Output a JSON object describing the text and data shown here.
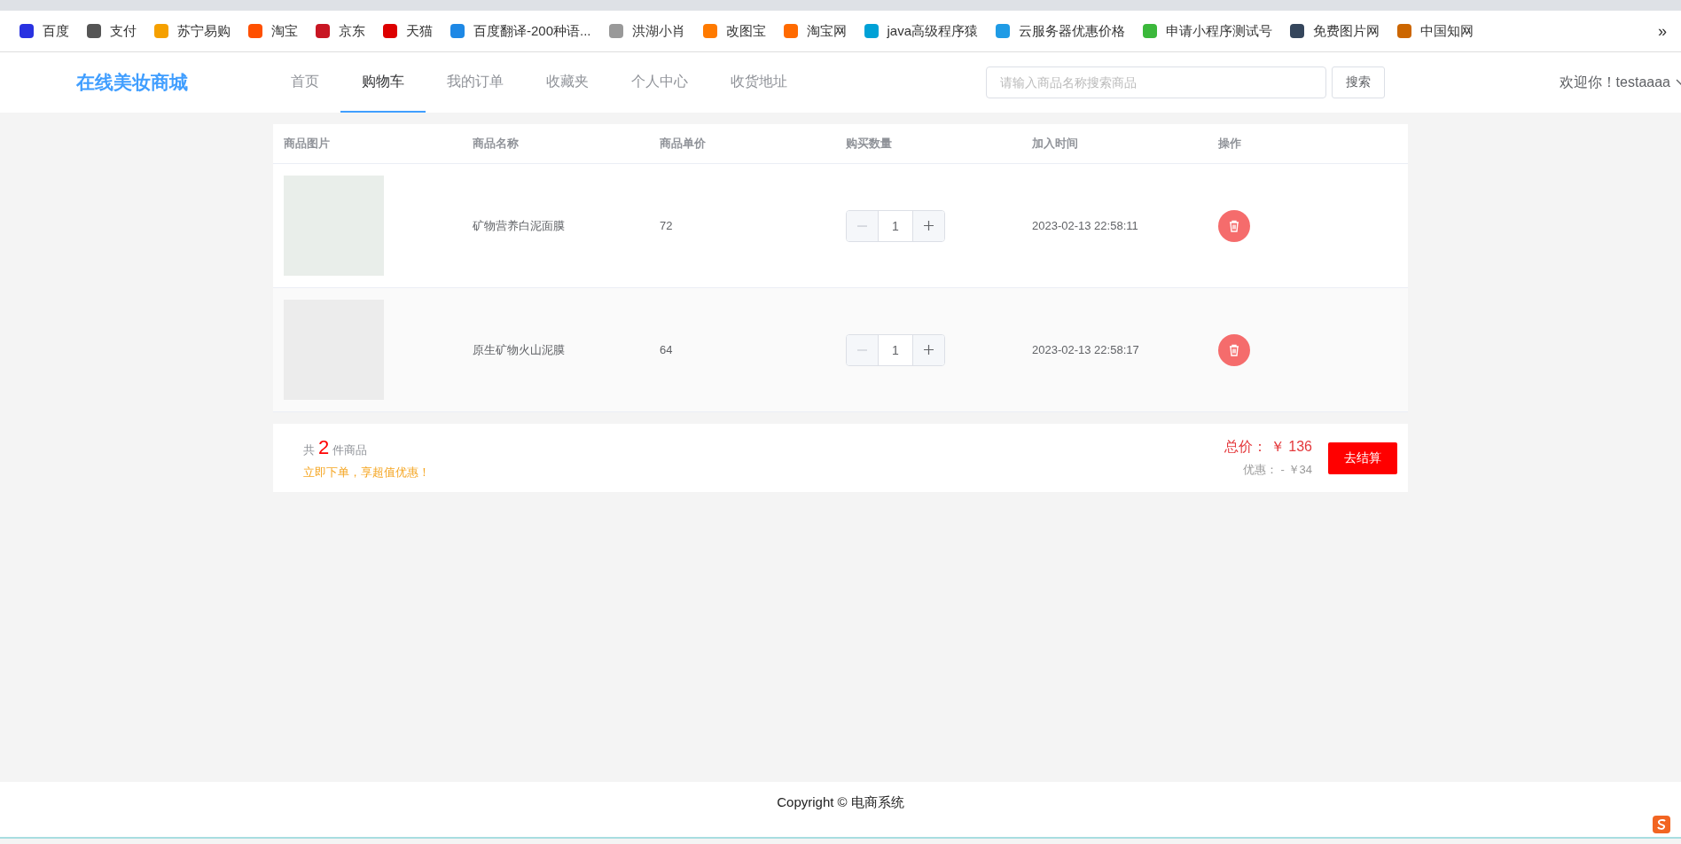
{
  "bookmarks": [
    {
      "label": "百度"
    },
    {
      "label": "支付"
    },
    {
      "label": "苏宁易购"
    },
    {
      "label": "淘宝"
    },
    {
      "label": "京东"
    },
    {
      "label": "天猫"
    },
    {
      "label": "百度翻译-200种语..."
    },
    {
      "label": "洪湖小肖"
    },
    {
      "label": "改图宝"
    },
    {
      "label": "淘宝网"
    },
    {
      "label": "java高级程序猿"
    },
    {
      "label": "云服务器优惠价格"
    },
    {
      "label": "申请小程序测试号"
    },
    {
      "label": "免费图片网"
    },
    {
      "label": "中国知网"
    }
  ],
  "bookmarks_more": "»",
  "header": {
    "logo": "在线美妆商城",
    "nav": [
      {
        "label": "首页",
        "selected": false
      },
      {
        "label": "购物车",
        "selected": true
      },
      {
        "label": "我的订单",
        "selected": false
      },
      {
        "label": "收藏夹",
        "selected": false
      },
      {
        "label": "个人中心",
        "selected": false
      },
      {
        "label": "收货地址",
        "selected": false
      }
    ],
    "search": {
      "placeholder": "请输入商品名称搜索商品",
      "button": "搜索"
    },
    "user": "欢迎你！testaaaa"
  },
  "cart": {
    "columns": [
      "商品图片",
      "商品名称",
      "商品单价",
      "购买数量",
      "加入时间",
      "操作"
    ],
    "rows": [
      {
        "name": "矿物营养白泥面膜",
        "price": "72",
        "quantity": "1",
        "decrease_disabled": true,
        "added": "2023-02-13 22:58:11"
      },
      {
        "name": "原生矿物火山泥膜",
        "price": "64",
        "quantity": "1",
        "decrease_disabled": true,
        "added": "2023-02-13 22:58:17"
      }
    ]
  },
  "summary": {
    "count_prefix": "共",
    "count": "2",
    "count_suffix": "件商品",
    "promo": "立即下单，享超值优惠！",
    "total_label": "总价：",
    "total": "￥ 136",
    "discount": "优惠： - ￥34",
    "checkout": "去结算"
  },
  "footer": {
    "copyright": "Copyright © 电商系统"
  }
}
